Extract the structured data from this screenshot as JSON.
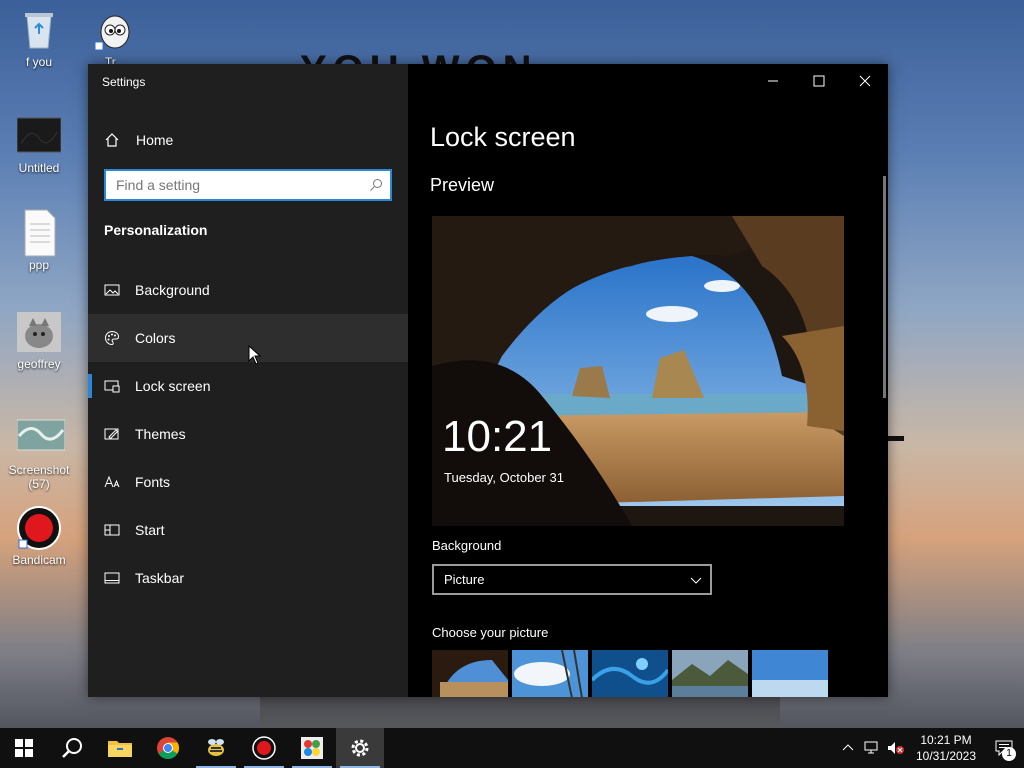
{
  "desktop": {
    "background_text": "YOU WON",
    "icons": [
      {
        "label": "f you",
        "icon": "recycle-bin-icon"
      },
      {
        "label": "Tr...",
        "icon": "cartoon-shortcut-icon"
      },
      {
        "label": "Untitled",
        "icon": "dark-image-icon"
      },
      {
        "label": "ppp",
        "icon": "document-icon"
      },
      {
        "label": "geoffrey",
        "icon": "cat-image-icon"
      },
      {
        "label": "Screenshot (57)",
        "icon": "screenshot-image-icon"
      },
      {
        "label": "Bandicam",
        "icon": "record-icon"
      }
    ]
  },
  "window": {
    "title": "Settings",
    "sidebar": {
      "home_label": "Home",
      "search_placeholder": "Find a setting",
      "section_label": "Personalization",
      "items": [
        {
          "label": "Background",
          "icon": "image-icon"
        },
        {
          "label": "Colors",
          "icon": "palette-icon"
        },
        {
          "label": "Lock screen",
          "icon": "lock-screen-icon"
        },
        {
          "label": "Themes",
          "icon": "themes-icon"
        },
        {
          "label": "Fonts",
          "icon": "fonts-icon"
        },
        {
          "label": "Start",
          "icon": "start-icon"
        },
        {
          "label": "Taskbar",
          "icon": "taskbar-icon"
        }
      ]
    },
    "content": {
      "page_title": "Lock screen",
      "preview_label": "Preview",
      "preview_time": "10:21",
      "preview_date": "Tuesday, October 31",
      "background_label": "Background",
      "background_value": "Picture",
      "choose_label": "Choose your picture"
    }
  },
  "taskbar": {
    "time": "10:21 PM",
    "date": "10/31/2023",
    "notification_count": "1",
    "apps": [
      "start-icon",
      "search-icon",
      "file-explorer-icon",
      "chrome-icon",
      "bee-app-icon",
      "bandicam-icon",
      "paint-app-icon",
      "settings-icon"
    ]
  },
  "colors": {
    "accent": "#2b88d8",
    "sidebar_bg": "#1f1f1f",
    "content_bg": "#000000"
  }
}
